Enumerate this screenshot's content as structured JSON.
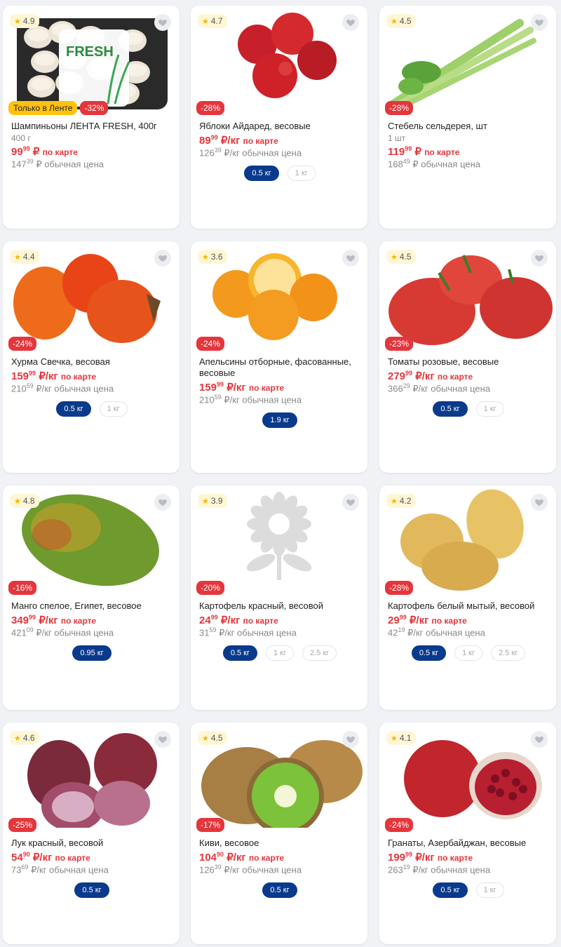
{
  "colors": {
    "discount": "#e4363c",
    "active_chip": "#0a3a8c",
    "exclusive": "#ffc20e",
    "star": "#f5b800"
  },
  "products": [
    {
      "rating": "4.9",
      "exclusive": "Только в Ленте",
      "discount": "-32%",
      "name": "Шампиньоны ЛЕНТА FRESH, 400г",
      "unit": "400 г",
      "price_int": "99",
      "price_frac": "99",
      "price_unit": "₽",
      "price_label": "по карте",
      "regular_int": "147",
      "regular_frac": "39",
      "regular_label": "₽ обычная цена",
      "image": "mushroom-package",
      "package_brand": "FRESH",
      "weights": []
    },
    {
      "rating": "4.7",
      "discount": "-28%",
      "name": "Яблоки Айдаред, весовые",
      "unit": "",
      "price_int": "89",
      "price_frac": "99",
      "price_unit": "₽/кг",
      "price_label": "по карте",
      "regular_int": "126",
      "regular_frac": "39",
      "regular_label": "₽/кг обычная цена",
      "image": "red-apples",
      "weights": [
        "0.5 кг",
        "1 кг"
      ],
      "active": 0
    },
    {
      "rating": "4.5",
      "discount": "-28%",
      "name": "Стебель сельдерея, шт",
      "unit": "1 шт",
      "price_int": "119",
      "price_frac": "99",
      "price_unit": "₽",
      "price_label": "по карте",
      "regular_int": "168",
      "regular_frac": "49",
      "regular_label": "₽ обычная цена",
      "image": "celery",
      "weights": []
    },
    {
      "rating": "4.4",
      "discount": "-24%",
      "name": "Хурма Свечка, весовая",
      "unit": "",
      "price_int": "159",
      "price_frac": "99",
      "price_unit": "₽/кг",
      "price_label": "по карте",
      "regular_int": "210",
      "regular_frac": "59",
      "regular_label": "₽/кг обычная цена",
      "image": "persimmon",
      "weights": [
        "0.5 кг",
        "1 кг"
      ],
      "active": 0
    },
    {
      "rating": "3.6",
      "discount": "-24%",
      "name": "Апельсины отборные, фасованные, весовые",
      "unit": "",
      "price_int": "159",
      "price_frac": "99",
      "price_unit": "₽/кг",
      "price_label": "по карте",
      "regular_int": "210",
      "regular_frac": "59",
      "regular_label": "₽/кг обычная цена",
      "image": "oranges",
      "weights": [
        "1.9 кг"
      ],
      "active": 0
    },
    {
      "rating": "4.5",
      "discount": "-23%",
      "name": "Томаты розовые, весовые",
      "unit": "",
      "price_int": "279",
      "price_frac": "99",
      "price_unit": "₽/кг",
      "price_label": "по карте",
      "regular_int": "366",
      "regular_frac": "29",
      "regular_label": "₽/кг обычная цена",
      "image": "tomatoes",
      "weights": [
        "0.5 кг",
        "1 кг"
      ],
      "active": 0
    },
    {
      "rating": "4.8",
      "discount": "-16%",
      "name": "Манго спелое, Египет, весовое",
      "unit": "",
      "price_int": "349",
      "price_frac": "99",
      "price_unit": "₽/кг",
      "price_label": "по карте",
      "regular_int": "421",
      "regular_frac": "09",
      "regular_label": "₽/кг обычная цена",
      "image": "mango",
      "weights": [
        "0.95 кг"
      ],
      "active": 0
    },
    {
      "rating": "3.9",
      "discount": "-20%",
      "name": "Картофель красный, весовой",
      "unit": "",
      "price_int": "24",
      "price_frac": "99",
      "price_unit": "₽/кг",
      "price_label": "по карте",
      "regular_int": "31",
      "regular_frac": "59",
      "regular_label": "₽/кг обычная цена",
      "image": "placeholder-flower",
      "weights": [
        "0.5 кг",
        "1 кг",
        "2.5 кг"
      ],
      "active": 0
    },
    {
      "rating": "4.2",
      "discount": "-28%",
      "name": "Картофель белый мытый, весовой",
      "unit": "",
      "price_int": "29",
      "price_frac": "99",
      "price_unit": "₽/кг",
      "price_label": "по карте",
      "regular_int": "42",
      "regular_frac": "19",
      "regular_label": "₽/кг обычная цена",
      "image": "potatoes",
      "weights": [
        "0.5 кг",
        "1 кг",
        "2.5 кг"
      ],
      "active": 0
    },
    {
      "rating": "4.6",
      "discount": "-25%",
      "name": "Лук красный, весовой",
      "unit": "",
      "price_int": "54",
      "price_frac": "90",
      "price_unit": "₽/кг",
      "price_label": "по карте",
      "regular_int": "73",
      "regular_frac": "69",
      "regular_label": "₽/кг обычная цена",
      "image": "red-onion",
      "weights": [
        "0.5 кг"
      ],
      "active": 0
    },
    {
      "rating": "4.5",
      "discount": "-17%",
      "name": "Киви, весовое",
      "unit": "",
      "price_int": "104",
      "price_frac": "90",
      "price_unit": "₽/кг",
      "price_label": "по карте",
      "regular_int": "126",
      "regular_frac": "39",
      "regular_label": "₽/кг обычная цена",
      "image": "kiwi",
      "weights": [
        "0.5 кг"
      ],
      "active": 0
    },
    {
      "rating": "4.1",
      "discount": "-24%",
      "name": "Гранаты, Азербайджан, весовые",
      "unit": "",
      "price_int": "199",
      "price_frac": "99",
      "price_unit": "₽/кг",
      "price_label": "по карте",
      "regular_int": "263",
      "regular_frac": "19",
      "regular_label": "₽/кг обычная цена",
      "image": "pomegranate",
      "weights": [
        "0.5 кг",
        "1 кг"
      ],
      "active": 0
    }
  ]
}
